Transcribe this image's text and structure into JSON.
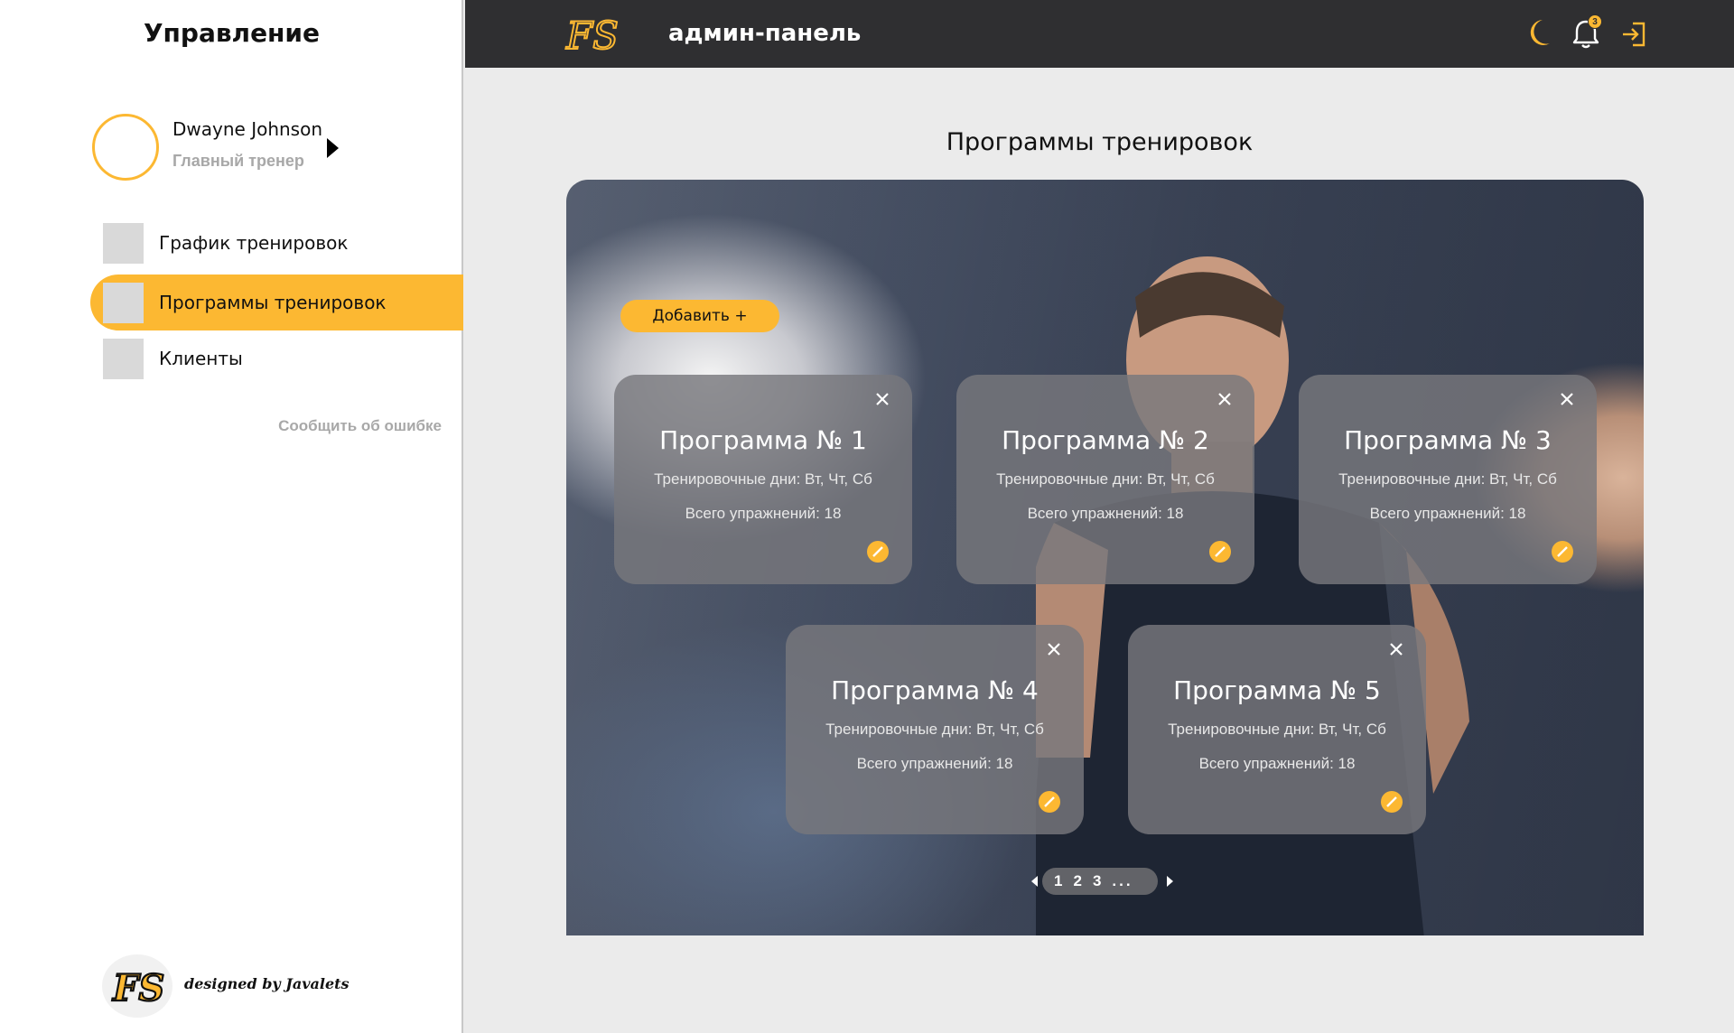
{
  "sidebar": {
    "title": "Управление",
    "profile": {
      "name": "Dwayne Johnson",
      "role": "Главный тренер"
    },
    "items": [
      {
        "label": "График тренировок",
        "active": false
      },
      {
        "label": "Программы тренировок",
        "active": true
      },
      {
        "label": "Клиенты",
        "active": false
      }
    ],
    "report_link": "Сообщить об ошибке",
    "footer_text": "designed by Javalets",
    "logo_text": "FS"
  },
  "header": {
    "logo_text": "FS",
    "title": "админ-панель",
    "icons": [
      "moon-icon",
      "bell-icon",
      "logout-icon"
    ],
    "notification_count": "3"
  },
  "main": {
    "title": "Программы тренировок",
    "add_button_label": "Добавить +",
    "programs": [
      {
        "title": "Программа № 1",
        "days": "Тренировочные дни: Вт, Чт, Сб",
        "exercises": "Всего упражнений: 18"
      },
      {
        "title": "Программа № 2",
        "days": "Тренировочные дни: Вт, Чт, Сб",
        "exercises": "Всего упражнений: 18"
      },
      {
        "title": "Программа № 3",
        "days": "Тренировочные дни: Вт, Чт, Сб",
        "exercises": "Всего упражнений: 18"
      },
      {
        "title": "Программа № 4",
        "days": "Тренировочные дни: Вт, Чт, Сб",
        "exercises": "Всего упражнений: 18"
      },
      {
        "title": "Программа № 5",
        "days": "Тренировочные дни: Вт, Чт, Сб",
        "exercises": "Всего упражнений: 18"
      }
    ],
    "pagination": {
      "pages": [
        "1",
        "2",
        "3"
      ],
      "ellipsis": "..."
    }
  },
  "colors": {
    "accent": "#fcb832",
    "header_bg": "#2f2f31",
    "page_bg": "#ebebeb",
    "card_bg": "#78787c"
  }
}
